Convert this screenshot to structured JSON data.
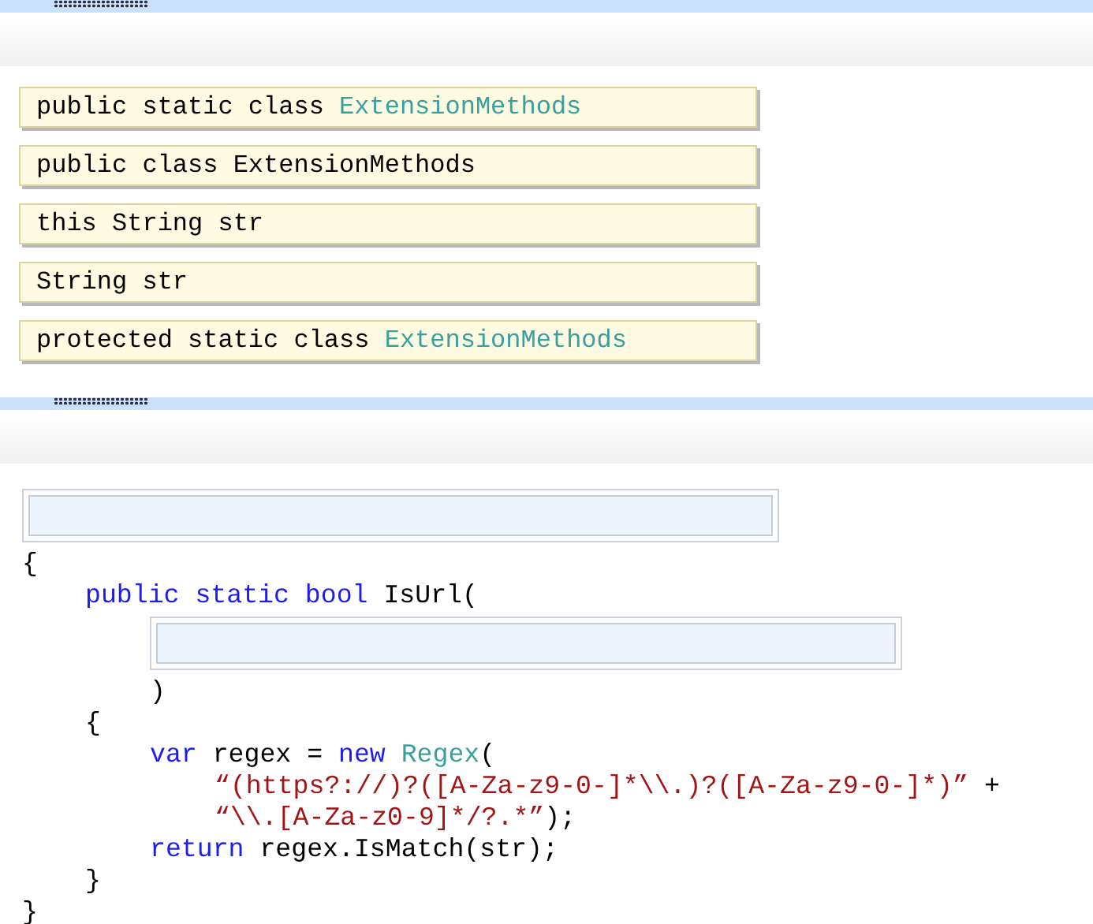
{
  "options": [
    {
      "tokens": [
        {
          "kind": "plain",
          "text": "public static class "
        },
        {
          "kind": "type",
          "text": "ExtensionMethods"
        }
      ]
    },
    {
      "tokens": [
        {
          "kind": "plain",
          "text": "public class ExtensionMethods"
        }
      ]
    },
    {
      "tokens": [
        {
          "kind": "plain",
          "text": "this String str"
        }
      ]
    },
    {
      "tokens": [
        {
          "kind": "plain",
          "text": "String str"
        }
      ]
    },
    {
      "tokens": [
        {
          "kind": "plain",
          "text": "protected static class "
        },
        {
          "kind": "type",
          "text": "ExtensionMethods"
        }
      ]
    }
  ],
  "code": [
    {
      "kind": "slot"
    },
    {
      "kind": "line",
      "tokens": [
        {
          "kind": "plain",
          "text": "{"
        }
      ]
    },
    {
      "kind": "member-line",
      "tokens": [
        {
          "kind": "keyword",
          "text": "public static bool "
        },
        {
          "kind": "plain",
          "text": "IsUrl("
        }
      ]
    },
    {
      "kind": "indented-slot"
    },
    {
      "kind": "body-line",
      "tokens": [
        {
          "kind": "plain",
          "text": ")"
        }
      ]
    },
    {
      "kind": "member-line",
      "tokens": [
        {
          "kind": "plain",
          "text": "{"
        }
      ]
    },
    {
      "kind": "body-line",
      "tokens": [
        {
          "kind": "keyword",
          "text": "var"
        },
        {
          "kind": "plain",
          "text": " regex = "
        },
        {
          "kind": "keyword",
          "text": "new "
        },
        {
          "kind": "type",
          "text": "Regex"
        },
        {
          "kind": "plain",
          "text": "("
        }
      ]
    },
    {
      "kind": "continuation-line",
      "tokens": [
        {
          "kind": "string",
          "text": "“(https?://)?([A-Za-z9-0-]*\\\\.)?([A-Za-z9-0-]*)”"
        },
        {
          "kind": "plain",
          "text": " +"
        }
      ]
    },
    {
      "kind": "continuation-line",
      "tokens": [
        {
          "kind": "string",
          "text": "“\\\\.[A-Za-z0-9]*/?.*”"
        },
        {
          "kind": "plain",
          "text": ");"
        }
      ]
    },
    {
      "kind": "body-line",
      "tokens": [
        {
          "kind": "keyword",
          "text": "return"
        },
        {
          "kind": "plain",
          "text": " regex.IsMatch(str);"
        }
      ]
    },
    {
      "kind": "member-line",
      "tokens": [
        {
          "kind": "plain",
          "text": "}"
        }
      ]
    },
    {
      "kind": "line",
      "tokens": [
        {
          "kind": "plain",
          "text": "}"
        }
      ]
    }
  ]
}
